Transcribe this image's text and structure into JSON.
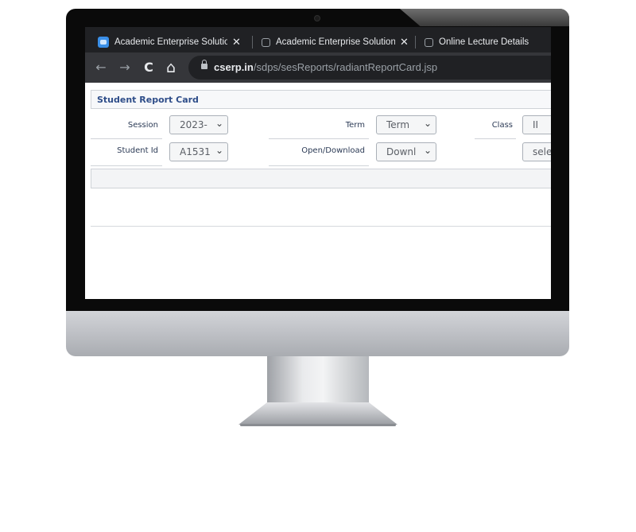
{
  "browser": {
    "tabs": [
      {
        "label": "Academic Enterprise Solution",
        "close": "✕",
        "icon": "app-favicon"
      },
      {
        "label": "Academic Enterprise Solution",
        "close": "✕",
        "icon": "globe-icon"
      },
      {
        "label": "Online Lecture Details",
        "icon": "globe-icon"
      }
    ],
    "nav": {
      "back": "←",
      "forward": "→",
      "reload": "C",
      "home": "⌂"
    },
    "url": {
      "host": "cserp.in",
      "path": "/sdps/sesReports/radiantReportCard.jsp"
    }
  },
  "page": {
    "title": "Student Report Card",
    "fields": {
      "session": {
        "label": "Session",
        "value": "2023-"
      },
      "term": {
        "label": "Term",
        "value": "Term"
      },
      "class": {
        "label": "Class",
        "value": "II"
      },
      "student_id": {
        "label": "Student Id",
        "value": "A1531"
      },
      "open_download": {
        "label": "Open/Download",
        "value": "Downl"
      },
      "section": {
        "value": "sele"
      }
    },
    "chevron": "⌄"
  }
}
